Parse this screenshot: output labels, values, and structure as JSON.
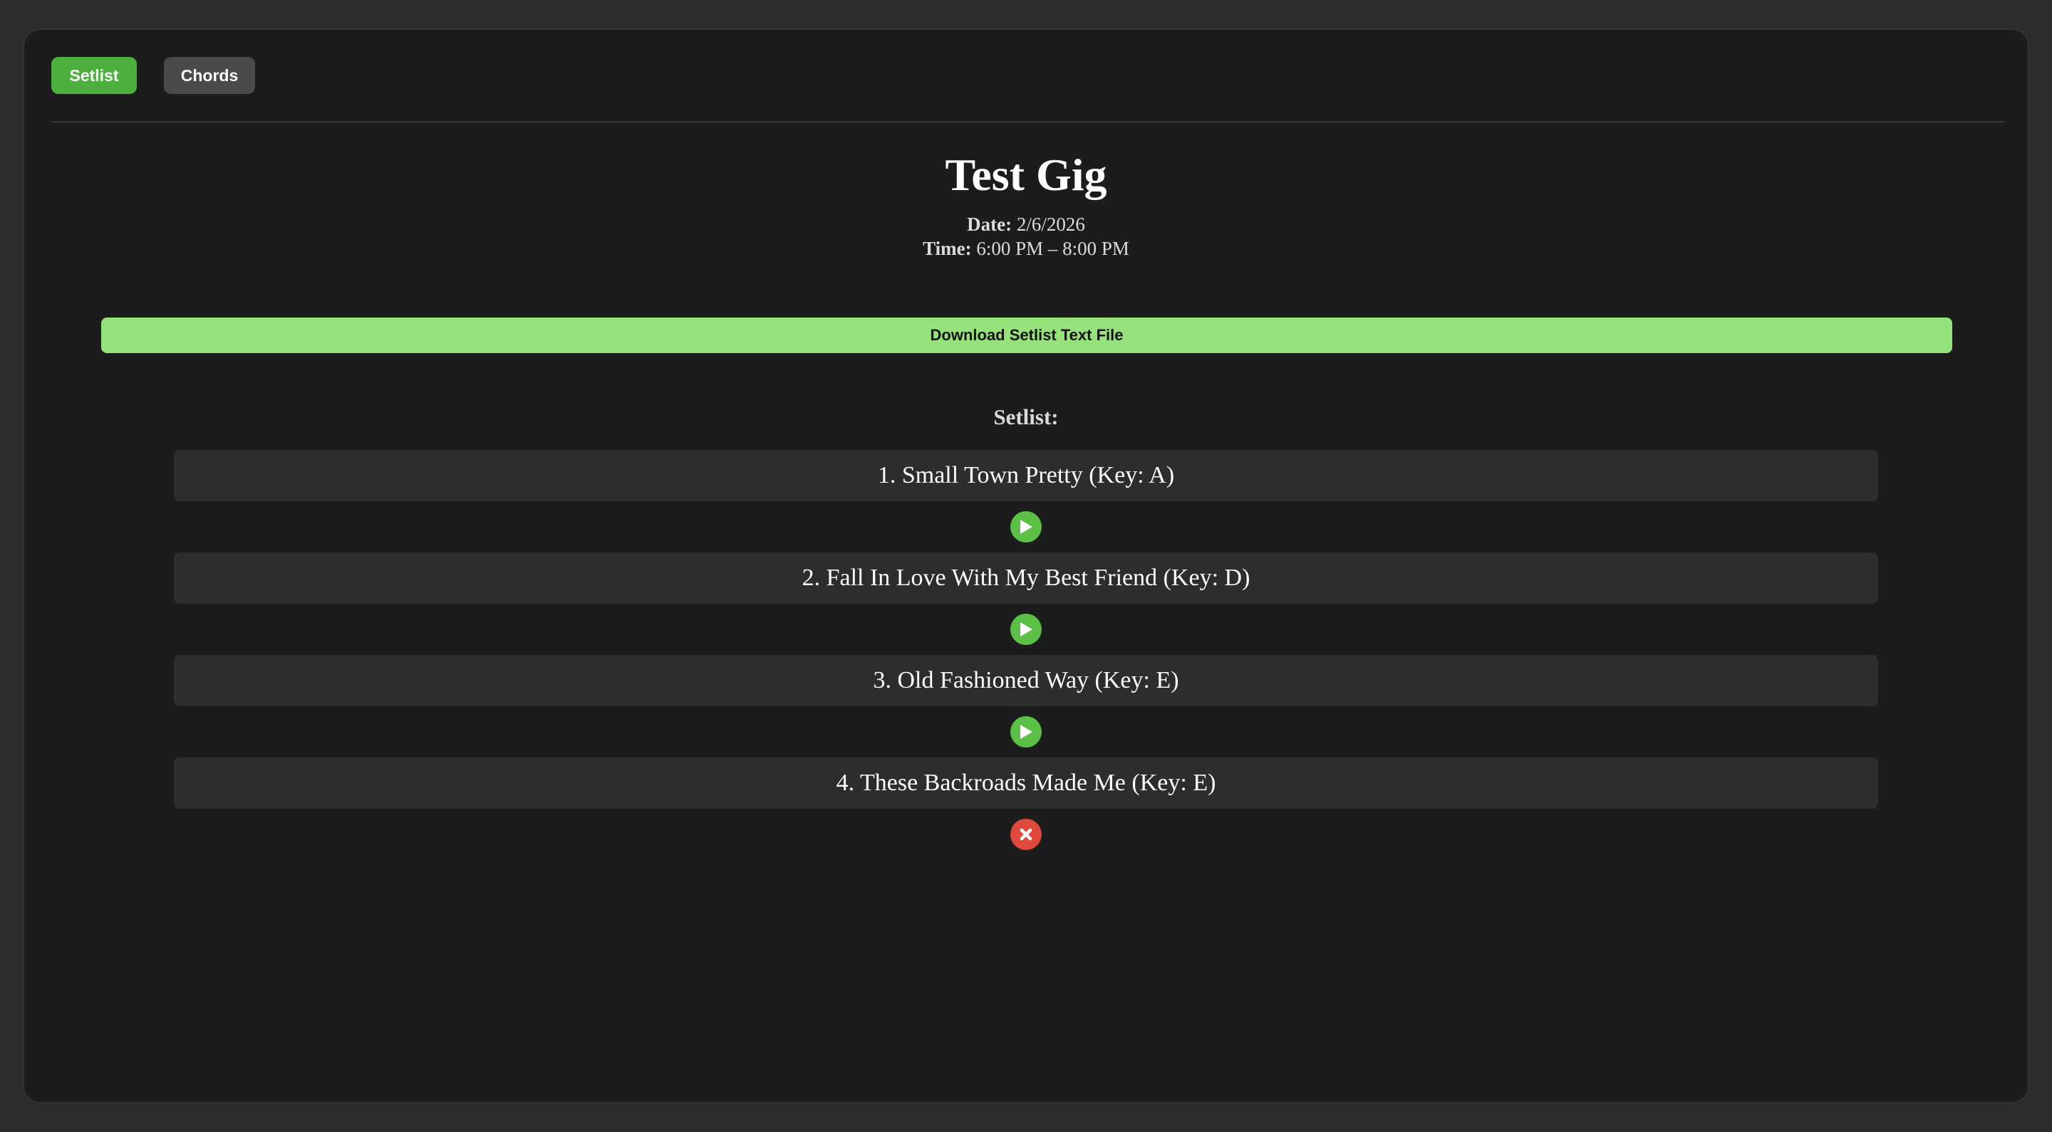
{
  "tabs": [
    {
      "label": "Setlist",
      "active": true
    },
    {
      "label": "Chords",
      "active": false
    }
  ],
  "gig": {
    "title": "Test Gig",
    "date_label": "Date:",
    "date": "2/6/2026",
    "time_label": "Time:",
    "time": "6:00 PM – 8:00 PM"
  },
  "download_button": "Download Setlist Text File",
  "setlist_heading": "Setlist:",
  "songs": [
    {
      "label": "1. Small Town Pretty (Key: A)",
      "control": "play-icon"
    },
    {
      "label": "2. Fall In Love With My Best Friend (Key: D)",
      "control": "play-icon"
    },
    {
      "label": "3. Old Fashioned Way (Key: E)",
      "control": "play-icon"
    },
    {
      "label": "4. These Backroads Made Me (Key: E)",
      "control": "remove-icon"
    }
  ],
  "colors": {
    "accent_green": "#4caf3e",
    "download_green": "#95e37a",
    "play_green": "#5cc046",
    "remove_red": "#e0483b",
    "background": "#1c1c1c"
  }
}
